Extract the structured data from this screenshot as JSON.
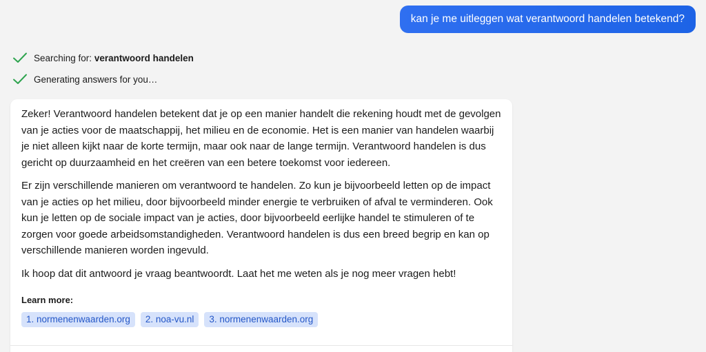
{
  "user_message": "kan je me uitleggen wat verantwoord handelen betekend?",
  "status": {
    "searching_prefix": "Searching for: ",
    "searching_query": "verantwoord handelen",
    "generating": "Generating answers for you…",
    "check_color": "#2ea44f"
  },
  "answer": {
    "paragraphs": [
      "Zeker! Verantwoord handelen betekent dat je op een manier handelt die rekening houdt met de gevolgen van je acties voor de maatschappij, het milieu en de economie. Het is een manier van handelen waarbij je niet alleen kijkt naar de korte termijn, maar ook naar de lange termijn. Verantwoord handelen is dus gericht op duurzaamheid en het creëren van een betere toekomst voor iedereen.",
      "Er zijn verschillende manieren om verantwoord te handelen. Zo kun je bijvoorbeeld letten op de impact van je acties op het milieu, door bijvoorbeeld minder energie te verbruiken of afval te verminderen. Ook kun je letten op de sociale impact van je acties, door bijvoorbeeld eerlijke handel te stimuleren of te zorgen voor goede arbeidsomstandigheden. Verantwoord handelen is dus een breed begrip en kan op verschillende manieren worden ingevuld.",
      "Ik hoop dat dit antwoord je vraag beantwoordt. Laat het me weten als je nog meer vragen hebt!"
    ],
    "learn_more_label": "Learn more:",
    "sources": [
      "1. normenenwaarden.org",
      "2. noa-vu.nl",
      "3. normenenwaarden.org"
    ]
  },
  "colors": {
    "user_bubble": "#2f6ff0",
    "chip_bg": "#d6e2fb",
    "chip_text": "#2457c7"
  }
}
